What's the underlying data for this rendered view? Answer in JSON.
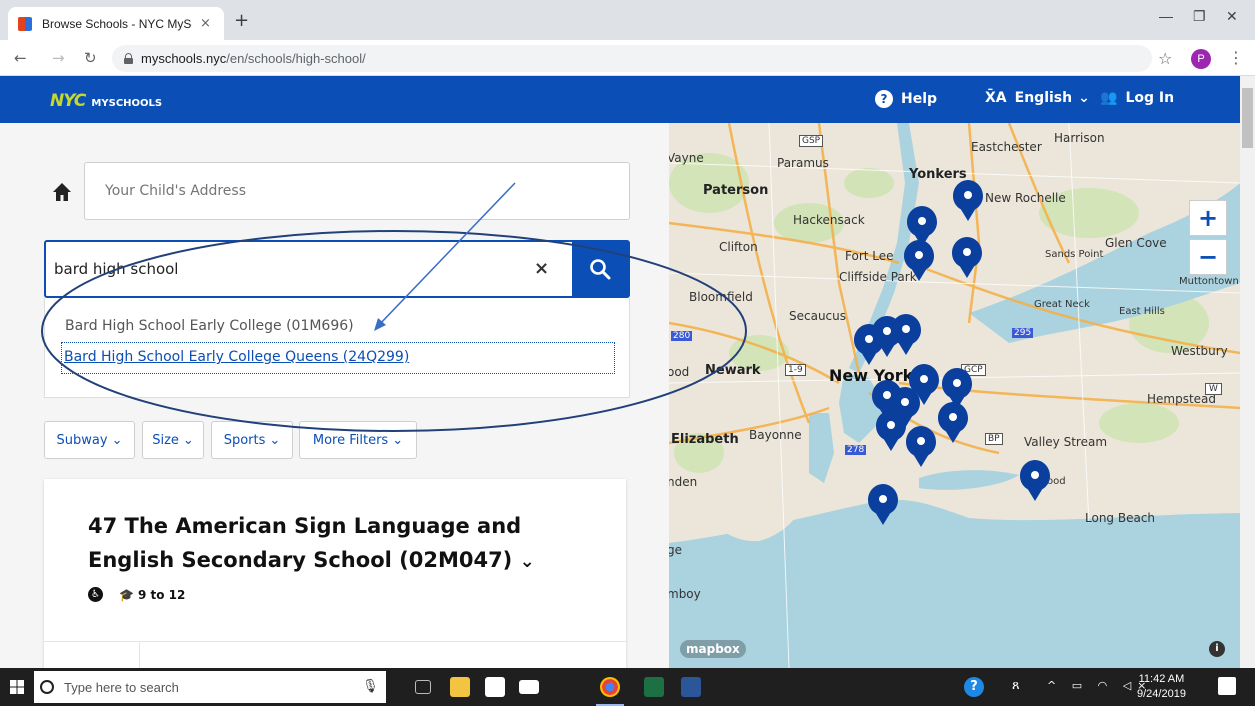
{
  "browser": {
    "tab_title": "Browse Schools - NYC MySchool",
    "tab_close": "×",
    "new_tab": "+",
    "url_host": "myschools.nyc",
    "url_path": "/en/schools/high-school/",
    "profile_initial": "P"
  },
  "header": {
    "logo_nyc": "NYC",
    "logo_text": "MYSCHOOLS",
    "help_label": "Help",
    "language_label": "English",
    "login_label": "Log In",
    "brand_color": "#0b4fb6",
    "logo_color": "#c4d82e"
  },
  "search": {
    "address_placeholder": "Your Child's Address",
    "query": "bard high school",
    "clear_symbol": "×",
    "suggestions": [
      "Bard High School Early College (01M696)",
      "Bard High School Early College Queens (24Q299)"
    ]
  },
  "filters": [
    "Subway",
    "Size",
    "Sports",
    "More Filters"
  ],
  "school_card": {
    "title": "47 The American Sign Language and English Secondary School (02M047)",
    "grades": "9 to 12"
  },
  "map": {
    "labels": {
      "paterson": "Paterson",
      "paramus": "Paramus",
      "wayne": "Vayne",
      "yonkers": "Yonkers",
      "eastchester": "Eastchester",
      "harrison": "Harrison",
      "new_rochelle": "New Rochelle",
      "hackensack": "Hackensack",
      "clifton": "Clifton",
      "fort_lee": "Fort Lee",
      "cliffside_park": "Cliffside Park",
      "glen_cove": "Glen Cove",
      "sands_point": "Sands Point",
      "muttontown": "Muttontown",
      "bloomfield": "Bloomfield",
      "secaucus": "Secaucus",
      "great_neck": "Great Neck",
      "east_hills": "East Hills",
      "westbury": "Westbury",
      "newark": "Newark",
      "new_york": "New York",
      "hempstead": "Hempstead",
      "elizabeth": "Elizabeth",
      "bayonne": "Bayonne",
      "valley_stream": "Valley Stream",
      "long_beach": "Long Beach",
      "linden": "nden",
      "ge": "ge",
      "amboy": "mboy",
      "ood": "ood",
      "ood2": "ood"
    },
    "shields": [
      "GSP",
      "295",
      "GCP",
      "278",
      "BP",
      "280",
      "1-9",
      "W"
    ],
    "zoom_in": "+",
    "zoom_out": "−",
    "attribution": "mapbox",
    "info": "i",
    "pin_color": "#0b3f9e"
  },
  "taskbar": {
    "search_placeholder": "Type here to search",
    "time": "11:42 AM",
    "date": "9/24/2019"
  }
}
